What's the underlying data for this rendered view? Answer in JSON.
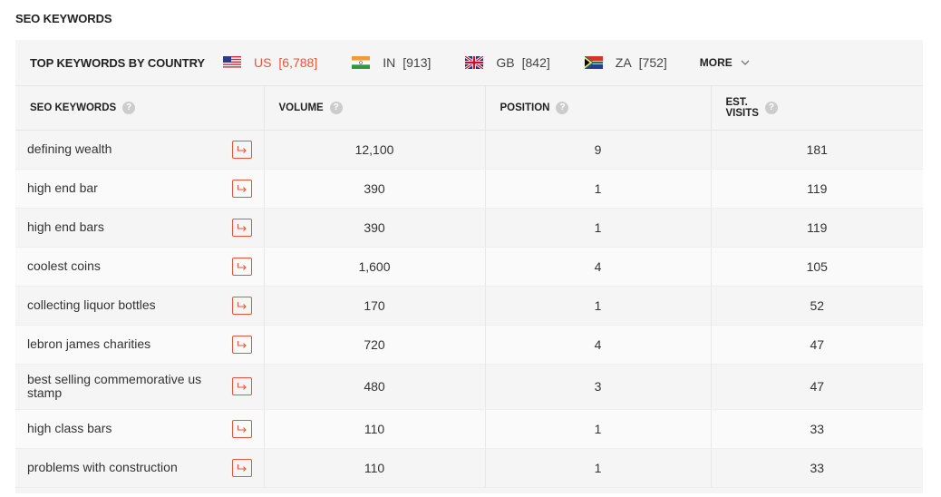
{
  "page_title": "SEO KEYWORDS",
  "countries_bar": {
    "title": "TOP KEYWORDS BY COUNTRY",
    "countries": [
      {
        "code": "US",
        "count": "[6,788]",
        "flag": "us-flag",
        "active": true
      },
      {
        "code": "IN",
        "count": "[913]",
        "flag": "india-flag",
        "active": false
      },
      {
        "code": "GB",
        "count": "[842]",
        "flag": "uk-flag",
        "active": false
      },
      {
        "code": "ZA",
        "count": "[752]",
        "flag": "south-africa-flag",
        "active": false
      }
    ],
    "more_label": "MORE"
  },
  "table": {
    "headers": {
      "keywords": "SEO KEYWORDS",
      "volume": "VOLUME",
      "position": "POSITION",
      "est_line1": "EST.",
      "est_line2": "VISITS",
      "help_glyph": "?"
    },
    "rows": [
      {
        "keyword": "defining wealth",
        "volume": "12,100",
        "position": "9",
        "visits": "181"
      },
      {
        "keyword": "high end bar",
        "volume": "390",
        "position": "1",
        "visits": "119"
      },
      {
        "keyword": "high end bars",
        "volume": "390",
        "position": "1",
        "visits": "119"
      },
      {
        "keyword": "coolest coins",
        "volume": "1,600",
        "position": "4",
        "visits": "105"
      },
      {
        "keyword": "collecting liquor bottles",
        "volume": "170",
        "position": "1",
        "visits": "52"
      },
      {
        "keyword": "lebron james charities",
        "volume": "720",
        "position": "4",
        "visits": "47"
      },
      {
        "keyword": "best selling commemorative us stamp",
        "volume": "480",
        "position": "3",
        "visits": "47"
      },
      {
        "keyword": "high class bars",
        "volume": "110",
        "position": "1",
        "visits": "33"
      },
      {
        "keyword": "problems with construction",
        "volume": "110",
        "position": "1",
        "visits": "33"
      }
    ]
  },
  "colors": {
    "accent": "#e8553a",
    "panel_bg": "#f5f5f5"
  }
}
